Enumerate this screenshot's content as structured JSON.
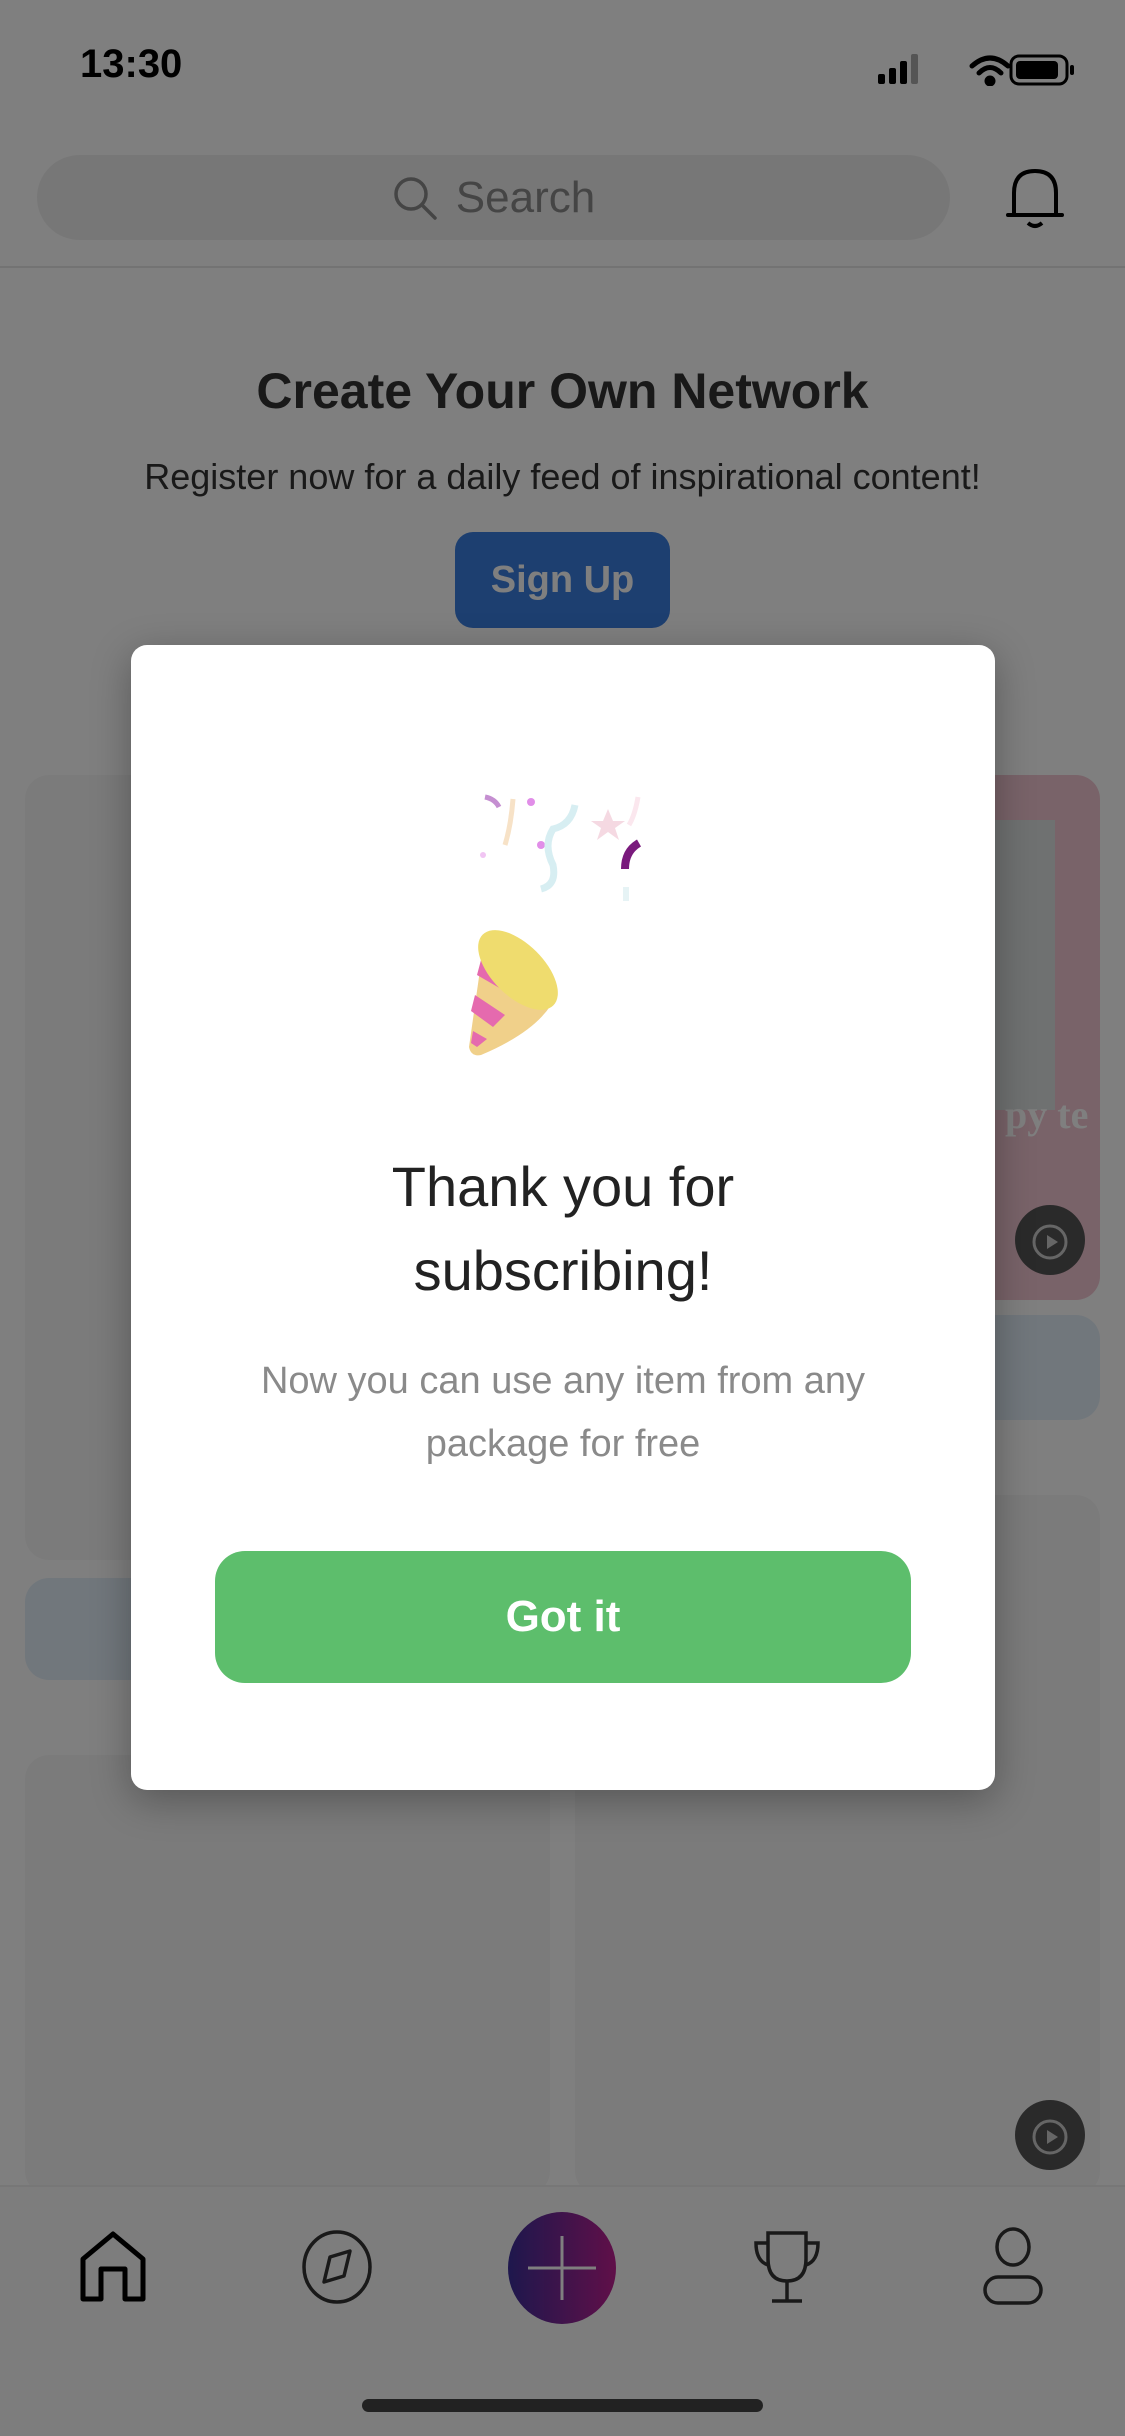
{
  "status_bar": {
    "time": "13:30",
    "icons": [
      "cellular-signal-icon",
      "wifi-icon",
      "battery-icon"
    ]
  },
  "header": {
    "search_placeholder": "Search",
    "icons": [
      "search-icon",
      "bell-icon"
    ]
  },
  "hero": {
    "title": "Create Your Own Network",
    "subtitle": "Register now for a daily feed of inspirational content!",
    "signup_label": "Sign Up"
  },
  "feed": {
    "card_text_fragment": "py te"
  },
  "modal": {
    "icon": "party-popper-icon",
    "title_line1": "Thank you for",
    "title_line2": "subscribing!",
    "body": "Now you can use any item from any package for free",
    "button_label": "Got it"
  },
  "tabbar": {
    "items": [
      "home-icon",
      "compass-icon",
      "plus-icon",
      "trophy-icon",
      "profile-icon"
    ]
  },
  "colors": {
    "accent_green": "#5dbe6c",
    "signup_blue": "#3b7fe0",
    "plus_gradient_start": "#3c2f9a",
    "plus_gradient_end": "#c01f92"
  }
}
